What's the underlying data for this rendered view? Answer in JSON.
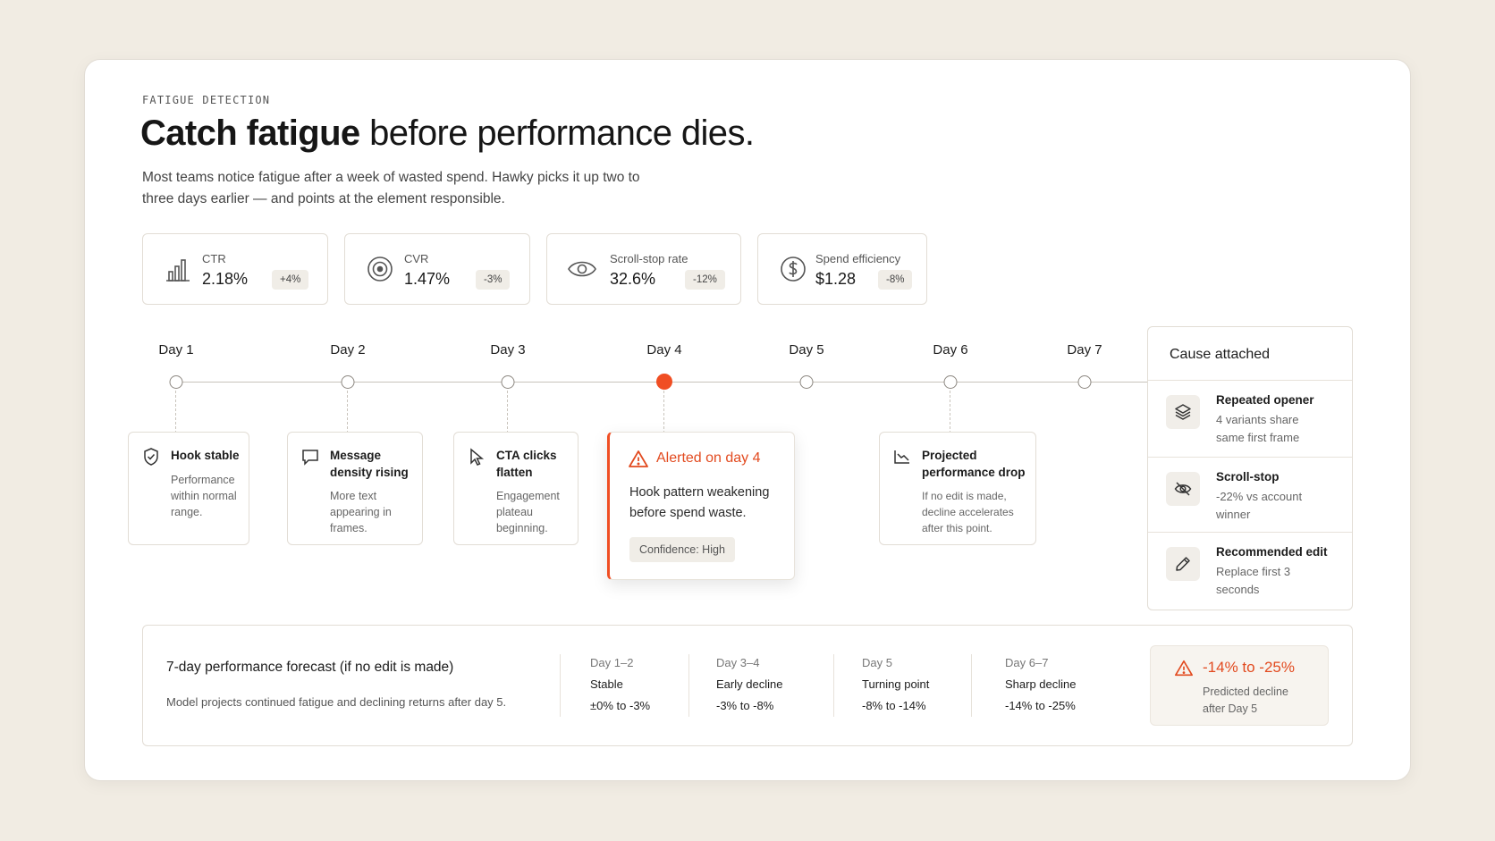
{
  "header": {
    "eyebrow": "FATIGUE DETECTION",
    "title_bold": "Catch fatigue",
    "title_rest": " before performance dies.",
    "subtitle": "Most teams notice fatigue after a week of wasted spend. Hawky picks it up two to three days earlier — and points at the element responsible."
  },
  "metrics": [
    {
      "icon": "bar-chart-icon",
      "label": "CTR",
      "value": "2.18%",
      "delta": "+4%"
    },
    {
      "icon": "target-icon",
      "label": "CVR",
      "value": "1.47%",
      "delta": "-3%"
    },
    {
      "icon": "eye-icon",
      "label": "Scroll-stop rate",
      "value": "32.6%",
      "delta": "-12%"
    },
    {
      "icon": "dollar-icon",
      "label": "Spend efficiency",
      "value": "$1.28",
      "delta": "-8%"
    }
  ],
  "timeline": {
    "days": [
      "Day 1",
      "Day 2",
      "Day 3",
      "Day 4",
      "Day 5",
      "Day 6",
      "Day 7"
    ],
    "alert_day_index": 3,
    "events": [
      {
        "icon": "shield-check-icon",
        "title": "Hook stable",
        "desc": "Performance within normal range."
      },
      {
        "icon": "message-icon",
        "title": "Message density rising",
        "desc": "More text appearing in frames."
      },
      {
        "icon": "cursor-icon",
        "title": "CTA clicks flatten",
        "desc": "Engagement plateau beginning."
      },
      {
        "icon": "trend-down-icon",
        "title": "Projected performance drop",
        "desc": "If no edit is made, decline accelerates after this point."
      }
    ],
    "alert": {
      "icon": "warning-icon",
      "title": "Alerted on day 4",
      "body": "Hook pattern weakening before spend waste.",
      "badge": "Confidence: High"
    }
  },
  "cause": {
    "title": "Cause attached",
    "items": [
      {
        "icon": "layers-icon",
        "name": "Repeated opener",
        "desc": "4 variants share same first frame"
      },
      {
        "icon": "eye-off-icon",
        "name": "Scroll-stop",
        "desc": "-22% vs account winner"
      },
      {
        "icon": "pencil-icon",
        "name": "Recommended edit",
        "desc": "Replace first 3 seconds"
      }
    ]
  },
  "forecast": {
    "title": "7-day performance forecast (if no edit is made)",
    "desc": "Model projects continued fatigue and declining returns after day 5.",
    "phases": [
      {
        "range": "Day 1–2",
        "name": "Stable",
        "value": "±0% to -3%"
      },
      {
        "range": "Day 3–4",
        "name": "Early decline",
        "value": "-3% to -8%"
      },
      {
        "range": "Day 5",
        "name": "Turning point",
        "value": "-8% to -14%"
      },
      {
        "range": "Day 6–7",
        "name": "Sharp decline",
        "value": "-14% to -25%"
      }
    ],
    "prediction": {
      "icon": "warning-icon",
      "range": "-14% to -25%",
      "label": "Predicted decline after Day 5"
    }
  },
  "colors": {
    "accent": "#f04e23",
    "background": "#f1ece3",
    "card": "#ffffff"
  }
}
